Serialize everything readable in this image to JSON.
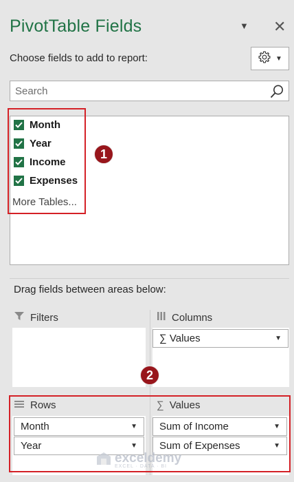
{
  "header": {
    "title": "PivotTable Fields",
    "choose_label": "Choose fields to add to report:"
  },
  "search": {
    "placeholder": "Search"
  },
  "fields": [
    {
      "label": "Month",
      "checked": true
    },
    {
      "label": "Year",
      "checked": true
    },
    {
      "label": "Income",
      "checked": true
    },
    {
      "label": "Expenses",
      "checked": true
    }
  ],
  "more_tables": "More Tables...",
  "drag_label": "Drag fields between areas below:",
  "areas": {
    "filters": {
      "label": "Filters",
      "items": []
    },
    "columns": {
      "label": "Columns",
      "items": [
        "∑ Values"
      ]
    },
    "rows": {
      "label": "Rows",
      "items": [
        "Month",
        "Year"
      ]
    },
    "values": {
      "label": "Values",
      "items": [
        "Sum of Income",
        "Sum of Expenses"
      ]
    }
  },
  "annotations": {
    "badge1": "1",
    "badge2": "2"
  },
  "watermark": {
    "name": "exceldemy",
    "tagline": "EXCEL · DATA · BI"
  },
  "colors": {
    "accent": "#217346",
    "highlight": "#d42026",
    "badge": "#98161c"
  }
}
